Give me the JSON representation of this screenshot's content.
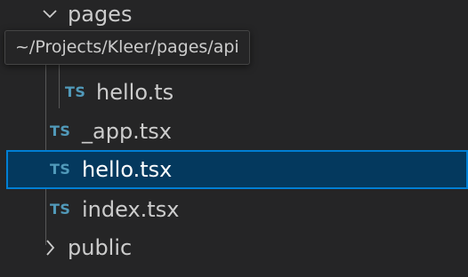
{
  "explorer": {
    "folder_pages": {
      "label": "pages",
      "icon": "chevron-down-icon"
    },
    "tooltip": {
      "text": "~/Projects/Kleer/pages/api"
    },
    "file_hello_ts": {
      "badge": "TS",
      "label": "hello.ts"
    },
    "file_app_tsx": {
      "badge": "TS",
      "label": "_app.tsx"
    },
    "file_hello_tsx": {
      "badge": "TS",
      "label": "hello.tsx"
    },
    "file_index_tsx": {
      "badge": "TS",
      "label": "index.tsx"
    },
    "folder_public": {
      "label": "public",
      "icon": "chevron-right-icon"
    }
  },
  "colors": {
    "background": "#252526",
    "text": "#cccccc",
    "ts_badge": "#519aba",
    "selection_bg": "#04395e",
    "selection_border": "#007fd4"
  }
}
